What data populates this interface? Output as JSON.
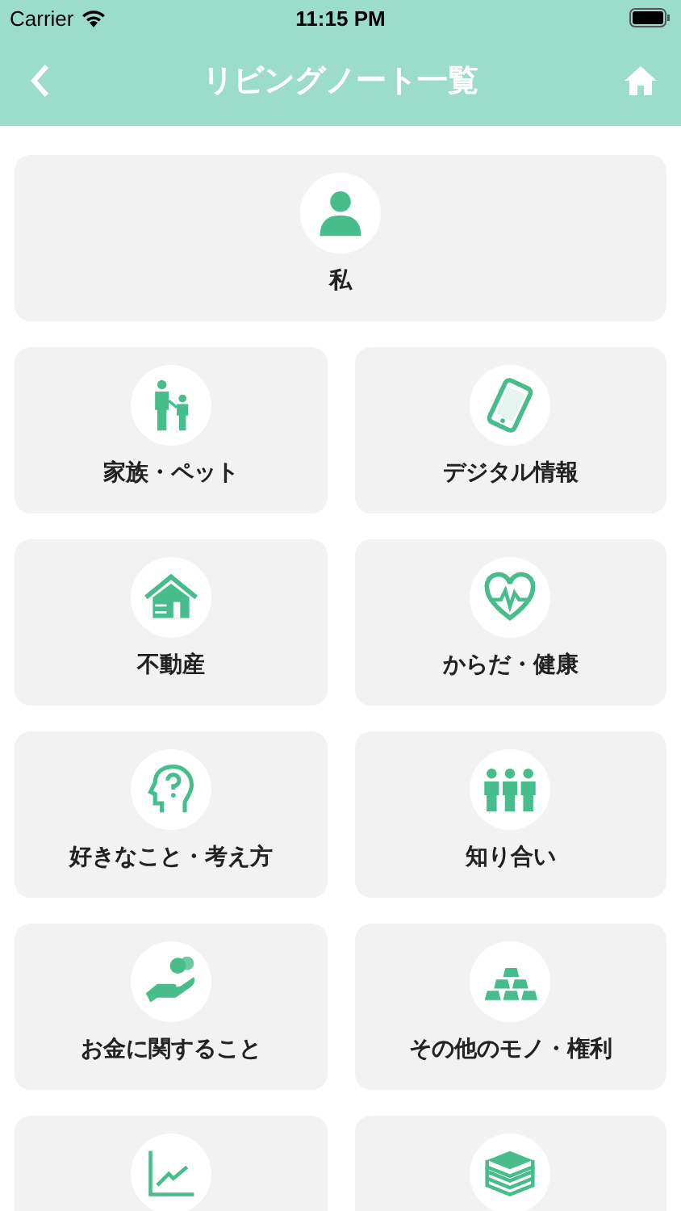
{
  "status_bar": {
    "carrier": "Carrier",
    "time": "11:15 PM"
  },
  "nav_bar": {
    "title": "リビングノート一覧"
  },
  "tiles": [
    {
      "kind": "person",
      "label": "私",
      "wide": true
    },
    {
      "kind": "family",
      "label": "家族・ペット"
    },
    {
      "kind": "phone",
      "label": "デジタル情報"
    },
    {
      "kind": "house",
      "label": "不動産"
    },
    {
      "kind": "heart",
      "label": "からだ・健康"
    },
    {
      "kind": "head",
      "label": "好きなこと・考え方"
    },
    {
      "kind": "people",
      "label": "知り合い"
    },
    {
      "kind": "money",
      "label": "お金に関すること"
    },
    {
      "kind": "gold",
      "label": "その他のモノ・権利"
    },
    {
      "kind": "chart"
    },
    {
      "kind": "books"
    }
  ]
}
